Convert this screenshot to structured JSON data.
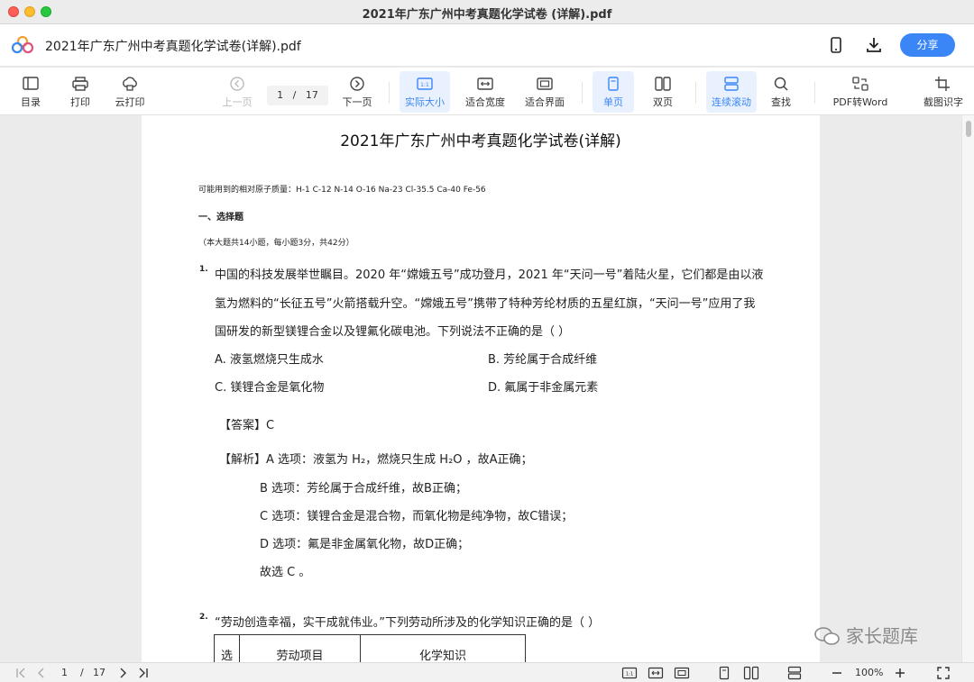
{
  "window": {
    "title": "2021年广东广州中考真题化学试卷 (详解).pdf"
  },
  "header": {
    "doc_name": "2021年广东广州中考真题化学试卷(详解).pdf",
    "share_label": "分享"
  },
  "toolbar": {
    "toc": "目录",
    "print": "打印",
    "cloud_print": "云打印",
    "prev": "上一页",
    "page_current": "1",
    "page_sep": "/",
    "page_total": "17",
    "next": "下一页",
    "actual_size": "实际大小",
    "actual_size_glyph": "1:1",
    "fit_width": "适合宽度",
    "fit_page": "适合界面",
    "single": "单页",
    "double": "双页",
    "continuous": "连续滚动",
    "find": "查找",
    "pdf_to_word": "PDF转Word",
    "ocr": "截图识字"
  },
  "doc": {
    "title": "2021年广东广州中考真题化学试卷(详解)",
    "atomic_mass": "可能用到的相对原子质量：H-1  C-12  N-14  O-16  Na-23  Cl-35.5  Ca-40  Fe-56",
    "section": "一、选择题",
    "section_note": "（本大题共14小题，每小题3分，共42分）",
    "q1": {
      "num": "1.",
      "line1": "中国的科技发展举世瞩目。2020 年“嫦娥五号”成功登月，2021 年“天问一号”着陆火星，它们都是由以液",
      "line2": "氢为燃料的“长征五号”火箭搭载升空。“嫦娥五号”携带了特种芳纶材质的五星红旗，“天问一号”应用了我",
      "line3": "国研发的新型镁锂合金以及锂氟化碳电池。下列说法不正确的是（     ）",
      "opt_a": "A. 液氢燃烧只生成水",
      "opt_b": "B. 芳纶属于合成纤维",
      "opt_c": "C. 镁锂合金是氧化物",
      "opt_d": "D. 氟属于非金属元素",
      "answer_label": "【答案】",
      "answer": "C",
      "analysis_label": "【解析】",
      "analysis_a": "A 选项：液氢为 H₂，燃烧只生成 H₂O ，故A正确；",
      "analysis_b": "B 选项：芳纶属于合成纤维，故B正确；",
      "analysis_c": "C 选项：镁锂合金是混合物，而氧化物是纯净物，故C错误；",
      "analysis_d": "D 选项：氟是非金属氧化物，故D正确；",
      "conclusion": "故选 C 。"
    },
    "q2": {
      "num": "2.",
      "line1": "“劳动创造幸福，实干成就伟业。”下列劳动所涉及的化学知识正确的是（     ）",
      "col1": "选",
      "col2": "劳动项目",
      "col3": "化学知识"
    }
  },
  "watermark": "家长题库",
  "bottom": {
    "page_current": "1",
    "page_sep": "/",
    "page_total": "17",
    "zoom": "100%"
  }
}
